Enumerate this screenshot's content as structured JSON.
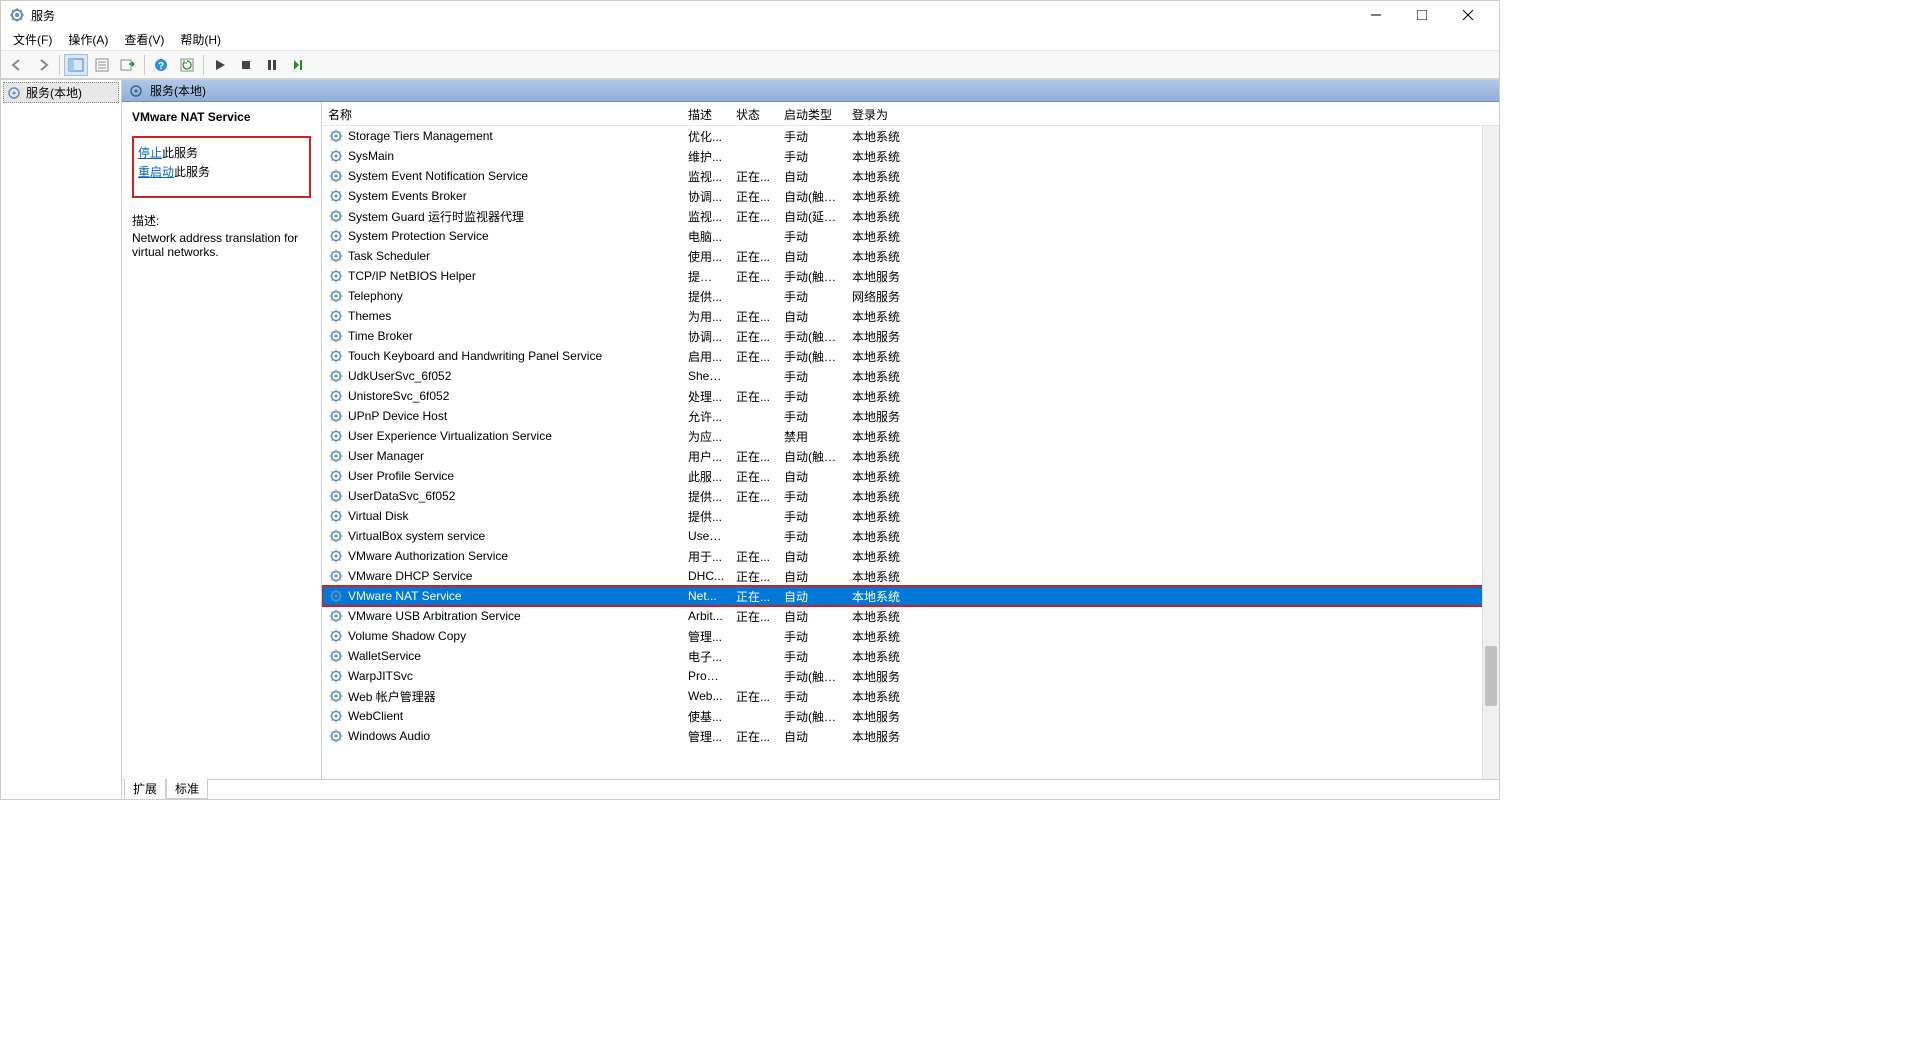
{
  "window": {
    "title": "服务"
  },
  "menubar": [
    "文件(F)",
    "操作(A)",
    "查看(V)",
    "帮助(H)"
  ],
  "tree": {
    "root": "服务(本地)"
  },
  "panel_header": "服务(本地)",
  "detail": {
    "service_name": "VMware NAT Service",
    "stop_link": "停止",
    "stop_suffix": "此服务",
    "restart_link": "重启动",
    "restart_suffix": "此服务",
    "desc_label": "描述:",
    "desc_text": "Network address translation for virtual networks."
  },
  "columns": {
    "name": "名称",
    "desc": "描述",
    "status": "状态",
    "startup": "启动类型",
    "logon": "登录为"
  },
  "services": [
    {
      "name": "Storage Tiers Management",
      "desc": "优化...",
      "status": "",
      "startup": "手动",
      "logon": "本地系统"
    },
    {
      "name": "SysMain",
      "desc": "维护...",
      "status": "",
      "startup": "手动",
      "logon": "本地系统"
    },
    {
      "name": "System Event Notification Service",
      "desc": "监视...",
      "status": "正在...",
      "startup": "自动",
      "logon": "本地系统"
    },
    {
      "name": "System Events Broker",
      "desc": "协调...",
      "status": "正在...",
      "startup": "自动(触发...",
      "logon": "本地系统"
    },
    {
      "name": "System Guard 运行时监视器代理",
      "desc": "监视...",
      "status": "正在...",
      "startup": "自动(延迟...",
      "logon": "本地系统"
    },
    {
      "name": "System Protection Service",
      "desc": "电脑...",
      "status": "",
      "startup": "手动",
      "logon": "本地系统"
    },
    {
      "name": "Task Scheduler",
      "desc": "使用...",
      "status": "正在...",
      "startup": "自动",
      "logon": "本地系统"
    },
    {
      "name": "TCP/IP NetBIOS Helper",
      "desc": "提供 ...",
      "status": "正在...",
      "startup": "手动(触发...",
      "logon": "本地服务"
    },
    {
      "name": "Telephony",
      "desc": "提供...",
      "status": "",
      "startup": "手动",
      "logon": "网络服务"
    },
    {
      "name": "Themes",
      "desc": "为用...",
      "status": "正在...",
      "startup": "自动",
      "logon": "本地系统"
    },
    {
      "name": "Time Broker",
      "desc": "协调...",
      "status": "正在...",
      "startup": "手动(触发...",
      "logon": "本地服务"
    },
    {
      "name": "Touch Keyboard and Handwriting Panel Service",
      "desc": "启用...",
      "status": "正在...",
      "startup": "手动(触发...",
      "logon": "本地系统"
    },
    {
      "name": "UdkUserSvc_6f052",
      "desc": "Shell...",
      "status": "",
      "startup": "手动",
      "logon": "本地系统"
    },
    {
      "name": "UnistoreSvc_6f052",
      "desc": "处理...",
      "status": "正在...",
      "startup": "手动",
      "logon": "本地系统"
    },
    {
      "name": "UPnP Device Host",
      "desc": "允许...",
      "status": "",
      "startup": "手动",
      "logon": "本地服务"
    },
    {
      "name": "User Experience Virtualization Service",
      "desc": "为应...",
      "status": "",
      "startup": "禁用",
      "logon": "本地系统"
    },
    {
      "name": "User Manager",
      "desc": "用户...",
      "status": "正在...",
      "startup": "自动(触发...",
      "logon": "本地系统"
    },
    {
      "name": "User Profile Service",
      "desc": "此服...",
      "status": "正在...",
      "startup": "自动",
      "logon": "本地系统"
    },
    {
      "name": "UserDataSvc_6f052",
      "desc": "提供...",
      "status": "正在...",
      "startup": "手动",
      "logon": "本地系统"
    },
    {
      "name": "Virtual Disk",
      "desc": "提供...",
      "status": "",
      "startup": "手动",
      "logon": "本地系统"
    },
    {
      "name": "VirtualBox system service",
      "desc": "Used...",
      "status": "",
      "startup": "手动",
      "logon": "本地系统"
    },
    {
      "name": "VMware Authorization Service",
      "desc": "用于...",
      "status": "正在...",
      "startup": "自动",
      "logon": "本地系统"
    },
    {
      "name": "VMware DHCP Service",
      "desc": "DHC...",
      "status": "正在...",
      "startup": "自动",
      "logon": "本地系统"
    },
    {
      "name": "VMware NAT Service",
      "desc": "Net...",
      "status": "正在...",
      "startup": "自动",
      "logon": "本地系统",
      "selected": true,
      "highlighted": true
    },
    {
      "name": "VMware USB Arbitration Service",
      "desc": "Arbit...",
      "status": "正在...",
      "startup": "自动",
      "logon": "本地系统"
    },
    {
      "name": "Volume Shadow Copy",
      "desc": "管理...",
      "status": "",
      "startup": "手动",
      "logon": "本地系统"
    },
    {
      "name": "WalletService",
      "desc": "电子...",
      "status": "",
      "startup": "手动",
      "logon": "本地系统"
    },
    {
      "name": "WarpJITSvc",
      "desc": "Provi...",
      "status": "",
      "startup": "手动(触发...",
      "logon": "本地服务"
    },
    {
      "name": "Web 帐户管理器",
      "desc": "Web...",
      "status": "正在...",
      "startup": "手动",
      "logon": "本地系统"
    },
    {
      "name": "WebClient",
      "desc": "使基...",
      "status": "",
      "startup": "手动(触发...",
      "logon": "本地服务"
    },
    {
      "name": "Windows Audio",
      "desc": "管理...",
      "status": "正在...",
      "startup": "自动",
      "logon": "本地服务"
    }
  ],
  "tabs": {
    "extended": "扩展",
    "standard": "标准"
  }
}
